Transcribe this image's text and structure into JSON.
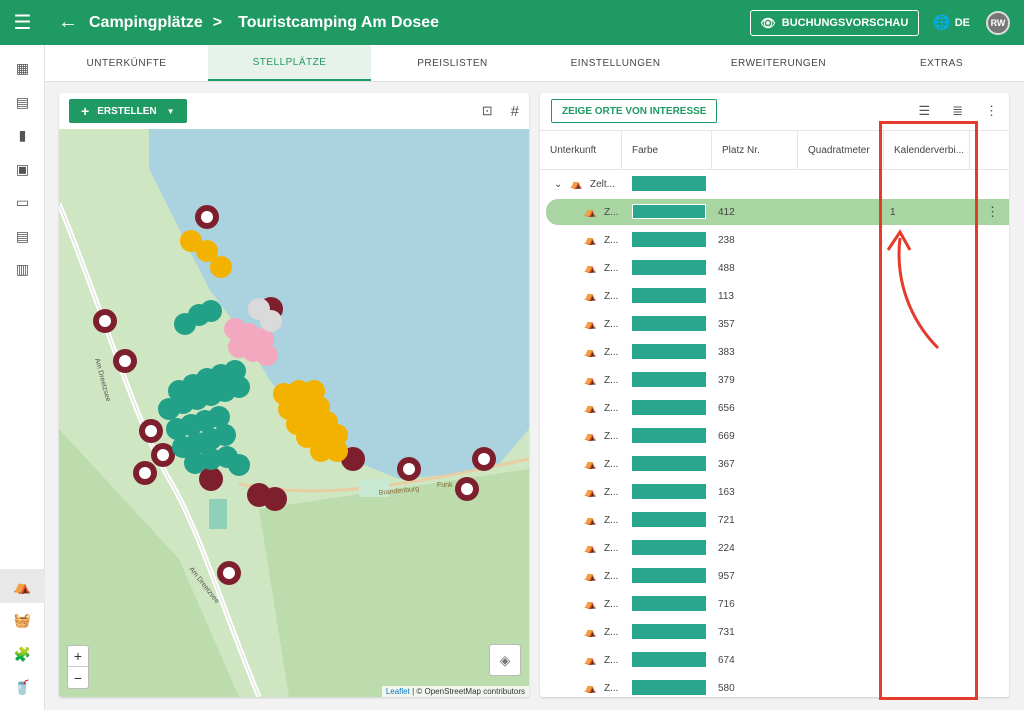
{
  "header": {
    "crumb1": "Campingplätze",
    "separator": ">",
    "crumb2": "Touristcamping Am Dosee",
    "preview_label": "BUCHUNGSVORSCHAU",
    "lang": "DE",
    "avatar": "RW"
  },
  "tabs": [
    "UNTERKÜNFTE",
    "STELLPLÄTZE",
    "PREISLISTEN",
    "EINSTELLUNGEN",
    "ERWEITERUNGEN",
    "EXTRAS"
  ],
  "map": {
    "create_label": "ERSTELLEN",
    "zoom_in": "+",
    "zoom_out": "−",
    "attrib_leaflet": "Leaflet",
    "attrib_rest": "| © OpenStreetMap contributors",
    "street1": "Am Dreetzsee",
    "street2": "Am Dreetzsee",
    "place1": "Brandenburg",
    "place2": "Funk"
  },
  "table": {
    "poi_label": "ZEIGE ORTE VON INTERESSE",
    "columns": [
      "Unterkunft",
      "Farbe",
      "Platz Nr.",
      "Quadratmeter",
      "Kalenderverbi..."
    ],
    "group_label": "Zelt...",
    "row_label": "Z...",
    "rows": [
      {
        "nr": "412",
        "cal": "1"
      },
      {
        "nr": "238",
        "cal": ""
      },
      {
        "nr": "488",
        "cal": ""
      },
      {
        "nr": "113",
        "cal": ""
      },
      {
        "nr": "357",
        "cal": ""
      },
      {
        "nr": "383",
        "cal": ""
      },
      {
        "nr": "379",
        "cal": ""
      },
      {
        "nr": "656",
        "cal": ""
      },
      {
        "nr": "669",
        "cal": ""
      },
      {
        "nr": "367",
        "cal": ""
      },
      {
        "nr": "163",
        "cal": ""
      },
      {
        "nr": "721",
        "cal": ""
      },
      {
        "nr": "224",
        "cal": ""
      },
      {
        "nr": "957",
        "cal": ""
      },
      {
        "nr": "716",
        "cal": ""
      },
      {
        "nr": "731",
        "cal": ""
      },
      {
        "nr": "674",
        "cal": ""
      },
      {
        "nr": "580",
        "cal": ""
      }
    ]
  },
  "colors": {
    "primary": "#1f9a63",
    "swatch": "#2aa58e",
    "selected_row": "#a8d5a2",
    "annotation": "#e43b2a"
  }
}
